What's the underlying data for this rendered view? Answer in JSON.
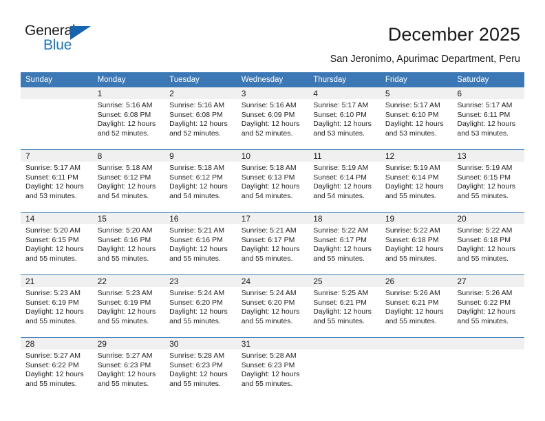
{
  "brand": {
    "name_top": "General",
    "name_bottom": "Blue",
    "triangle_color": "#1565b0",
    "blue_text_color": "#1b78c4"
  },
  "header": {
    "title": "December 2025",
    "subtitle": "San Jeronimo, Apurimac Department, Peru"
  },
  "theme": {
    "header_bg": "#3c78b5",
    "header_text": "#ffffff",
    "daynum_band_bg": "#f0f0f0",
    "row_divider": "#3c78b5",
    "body_text": "#222222"
  },
  "calendar": {
    "weekday_headers": [
      "Sunday",
      "Monday",
      "Tuesday",
      "Wednesday",
      "Thursday",
      "Friday",
      "Saturday"
    ],
    "weeks": [
      [
        {
          "day": "",
          "sunrise": "",
          "sunset": "",
          "daylight_1": "",
          "daylight_2": "",
          "empty": true
        },
        {
          "day": "1",
          "sunrise": "Sunrise: 5:16 AM",
          "sunset": "Sunset: 6:08 PM",
          "daylight_1": "Daylight: 12 hours",
          "daylight_2": "and 52 minutes."
        },
        {
          "day": "2",
          "sunrise": "Sunrise: 5:16 AM",
          "sunset": "Sunset: 6:08 PM",
          "daylight_1": "Daylight: 12 hours",
          "daylight_2": "and 52 minutes."
        },
        {
          "day": "3",
          "sunrise": "Sunrise: 5:16 AM",
          "sunset": "Sunset: 6:09 PM",
          "daylight_1": "Daylight: 12 hours",
          "daylight_2": "and 52 minutes."
        },
        {
          "day": "4",
          "sunrise": "Sunrise: 5:17 AM",
          "sunset": "Sunset: 6:10 PM",
          "daylight_1": "Daylight: 12 hours",
          "daylight_2": "and 53 minutes."
        },
        {
          "day": "5",
          "sunrise": "Sunrise: 5:17 AM",
          "sunset": "Sunset: 6:10 PM",
          "daylight_1": "Daylight: 12 hours",
          "daylight_2": "and 53 minutes."
        },
        {
          "day": "6",
          "sunrise": "Sunrise: 5:17 AM",
          "sunset": "Sunset: 6:11 PM",
          "daylight_1": "Daylight: 12 hours",
          "daylight_2": "and 53 minutes."
        }
      ],
      [
        {
          "day": "7",
          "sunrise": "Sunrise: 5:17 AM",
          "sunset": "Sunset: 6:11 PM",
          "daylight_1": "Daylight: 12 hours",
          "daylight_2": "and 53 minutes."
        },
        {
          "day": "8",
          "sunrise": "Sunrise: 5:18 AM",
          "sunset": "Sunset: 6:12 PM",
          "daylight_1": "Daylight: 12 hours",
          "daylight_2": "and 54 minutes."
        },
        {
          "day": "9",
          "sunrise": "Sunrise: 5:18 AM",
          "sunset": "Sunset: 6:12 PM",
          "daylight_1": "Daylight: 12 hours",
          "daylight_2": "and 54 minutes."
        },
        {
          "day": "10",
          "sunrise": "Sunrise: 5:18 AM",
          "sunset": "Sunset: 6:13 PM",
          "daylight_1": "Daylight: 12 hours",
          "daylight_2": "and 54 minutes."
        },
        {
          "day": "11",
          "sunrise": "Sunrise: 5:19 AM",
          "sunset": "Sunset: 6:14 PM",
          "daylight_1": "Daylight: 12 hours",
          "daylight_2": "and 54 minutes."
        },
        {
          "day": "12",
          "sunrise": "Sunrise: 5:19 AM",
          "sunset": "Sunset: 6:14 PM",
          "daylight_1": "Daylight: 12 hours",
          "daylight_2": "and 55 minutes."
        },
        {
          "day": "13",
          "sunrise": "Sunrise: 5:19 AM",
          "sunset": "Sunset: 6:15 PM",
          "daylight_1": "Daylight: 12 hours",
          "daylight_2": "and 55 minutes."
        }
      ],
      [
        {
          "day": "14",
          "sunrise": "Sunrise: 5:20 AM",
          "sunset": "Sunset: 6:15 PM",
          "daylight_1": "Daylight: 12 hours",
          "daylight_2": "and 55 minutes."
        },
        {
          "day": "15",
          "sunrise": "Sunrise: 5:20 AM",
          "sunset": "Sunset: 6:16 PM",
          "daylight_1": "Daylight: 12 hours",
          "daylight_2": "and 55 minutes."
        },
        {
          "day": "16",
          "sunrise": "Sunrise: 5:21 AM",
          "sunset": "Sunset: 6:16 PM",
          "daylight_1": "Daylight: 12 hours",
          "daylight_2": "and 55 minutes."
        },
        {
          "day": "17",
          "sunrise": "Sunrise: 5:21 AM",
          "sunset": "Sunset: 6:17 PM",
          "daylight_1": "Daylight: 12 hours",
          "daylight_2": "and 55 minutes."
        },
        {
          "day": "18",
          "sunrise": "Sunrise: 5:22 AM",
          "sunset": "Sunset: 6:17 PM",
          "daylight_1": "Daylight: 12 hours",
          "daylight_2": "and 55 minutes."
        },
        {
          "day": "19",
          "sunrise": "Sunrise: 5:22 AM",
          "sunset": "Sunset: 6:18 PM",
          "daylight_1": "Daylight: 12 hours",
          "daylight_2": "and 55 minutes."
        },
        {
          "day": "20",
          "sunrise": "Sunrise: 5:22 AM",
          "sunset": "Sunset: 6:18 PM",
          "daylight_1": "Daylight: 12 hours",
          "daylight_2": "and 55 minutes."
        }
      ],
      [
        {
          "day": "21",
          "sunrise": "Sunrise: 5:23 AM",
          "sunset": "Sunset: 6:19 PM",
          "daylight_1": "Daylight: 12 hours",
          "daylight_2": "and 55 minutes."
        },
        {
          "day": "22",
          "sunrise": "Sunrise: 5:23 AM",
          "sunset": "Sunset: 6:19 PM",
          "daylight_1": "Daylight: 12 hours",
          "daylight_2": "and 55 minutes."
        },
        {
          "day": "23",
          "sunrise": "Sunrise: 5:24 AM",
          "sunset": "Sunset: 6:20 PM",
          "daylight_1": "Daylight: 12 hours",
          "daylight_2": "and 55 minutes."
        },
        {
          "day": "24",
          "sunrise": "Sunrise: 5:24 AM",
          "sunset": "Sunset: 6:20 PM",
          "daylight_1": "Daylight: 12 hours",
          "daylight_2": "and 55 minutes."
        },
        {
          "day": "25",
          "sunrise": "Sunrise: 5:25 AM",
          "sunset": "Sunset: 6:21 PM",
          "daylight_1": "Daylight: 12 hours",
          "daylight_2": "and 55 minutes."
        },
        {
          "day": "26",
          "sunrise": "Sunrise: 5:26 AM",
          "sunset": "Sunset: 6:21 PM",
          "daylight_1": "Daylight: 12 hours",
          "daylight_2": "and 55 minutes."
        },
        {
          "day": "27",
          "sunrise": "Sunrise: 5:26 AM",
          "sunset": "Sunset: 6:22 PM",
          "daylight_1": "Daylight: 12 hours",
          "daylight_2": "and 55 minutes."
        }
      ],
      [
        {
          "day": "28",
          "sunrise": "Sunrise: 5:27 AM",
          "sunset": "Sunset: 6:22 PM",
          "daylight_1": "Daylight: 12 hours",
          "daylight_2": "and 55 minutes."
        },
        {
          "day": "29",
          "sunrise": "Sunrise: 5:27 AM",
          "sunset": "Sunset: 6:23 PM",
          "daylight_1": "Daylight: 12 hours",
          "daylight_2": "and 55 minutes."
        },
        {
          "day": "30",
          "sunrise": "Sunrise: 5:28 AM",
          "sunset": "Sunset: 6:23 PM",
          "daylight_1": "Daylight: 12 hours",
          "daylight_2": "and 55 minutes."
        },
        {
          "day": "31",
          "sunrise": "Sunrise: 5:28 AM",
          "sunset": "Sunset: 6:23 PM",
          "daylight_1": "Daylight: 12 hours",
          "daylight_2": "and 55 minutes."
        },
        {
          "day": "",
          "sunrise": "",
          "sunset": "",
          "daylight_1": "",
          "daylight_2": "",
          "empty": true
        },
        {
          "day": "",
          "sunrise": "",
          "sunset": "",
          "daylight_1": "",
          "daylight_2": "",
          "empty": true
        },
        {
          "day": "",
          "sunrise": "",
          "sunset": "",
          "daylight_1": "",
          "daylight_2": "",
          "empty": true
        }
      ]
    ]
  }
}
